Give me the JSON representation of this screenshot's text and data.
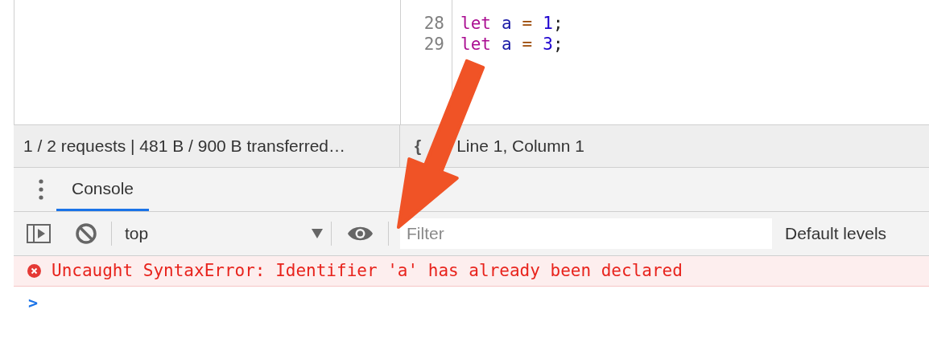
{
  "editor": {
    "lines": [
      {
        "number": "28",
        "tokens": [
          {
            "kind": "keyword",
            "text": "let"
          },
          {
            "kind": "variable",
            "text": "a"
          },
          {
            "kind": "operator",
            "text": "="
          },
          {
            "kind": "number",
            "text": "1"
          },
          {
            "kind": "punct",
            "text": ";"
          }
        ]
      },
      {
        "number": "29",
        "tokens": [
          {
            "kind": "keyword",
            "text": "let"
          },
          {
            "kind": "variable",
            "text": "a"
          },
          {
            "kind": "operator",
            "text": "="
          },
          {
            "kind": "number",
            "text": "3"
          },
          {
            "kind": "punct",
            "text": ";"
          }
        ]
      }
    ]
  },
  "status_bar": {
    "requests": "1 / 2 requests | 481 B / 900 B transferred…",
    "pretty_print": "{",
    "position": "Line 1, Column 1"
  },
  "drawer": {
    "tabs": [
      {
        "label": "Console",
        "selected": true
      }
    ]
  },
  "toolbar": {
    "context": "top",
    "filter": {
      "placeholder": "Filter"
    },
    "levels": "Default levels"
  },
  "messages": [
    {
      "kind": "error",
      "text": "Uncaught SyntaxError: Identifier 'a' has already been declared"
    },
    {
      "kind": "prompt",
      "text": ">"
    }
  ]
}
